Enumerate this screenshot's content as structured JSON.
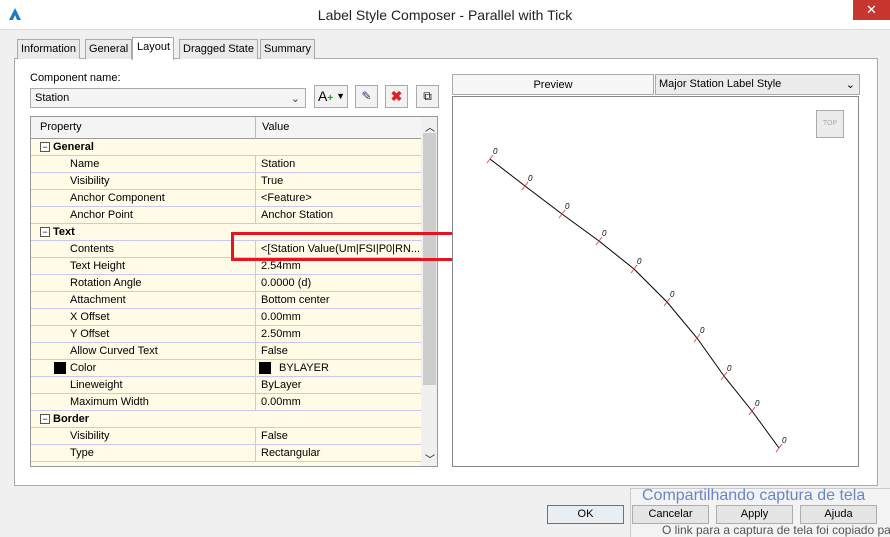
{
  "window": {
    "title": "Label Style Composer - Parallel with Tick",
    "close_icon": "close-icon"
  },
  "tabs": [
    {
      "label": "Information"
    },
    {
      "label": "General"
    },
    {
      "label": "Layout",
      "active": true
    },
    {
      "label": "Dragged State"
    },
    {
      "label": "Summary"
    }
  ],
  "component": {
    "label": "Component name:",
    "value": "Station"
  },
  "toolbar": {
    "add_text": "A",
    "add_icon": "add-text-component-icon",
    "copy_icon": "copy-component-icon",
    "delete_icon": "delete-icon",
    "order_icon": "component-draw-order-icon"
  },
  "grid": {
    "headers": [
      "Property",
      "Value"
    ],
    "rows": [
      {
        "type": "cat",
        "name": "General"
      },
      {
        "name": "Name",
        "value": "Station"
      },
      {
        "name": "Visibility",
        "value": "True"
      },
      {
        "name": "Anchor Component",
        "value": "<Feature>"
      },
      {
        "name": "Anchor Point",
        "value": "Anchor Station"
      },
      {
        "type": "cat",
        "name": "Text"
      },
      {
        "name": "Contents",
        "value": "<[Station Value(Um|FSI|P0|RN..."
      },
      {
        "name": "Text Height",
        "value": "2.54mm"
      },
      {
        "name": "Rotation Angle",
        "value": "0.0000 (d)"
      },
      {
        "name": "Attachment",
        "value": "Bottom center"
      },
      {
        "name": "X Offset",
        "value": "0.00mm"
      },
      {
        "name": "Y Offset",
        "value": "2.50mm"
      },
      {
        "name": "Allow Curved Text",
        "value": "False"
      },
      {
        "name": "Color",
        "value": "BYLAYER",
        "swatch": "#000000"
      },
      {
        "name": "Lineweight",
        "value": "ByLayer"
      },
      {
        "name": "Maximum Width",
        "value": "0.00mm"
      },
      {
        "type": "cat",
        "name": "Border"
      },
      {
        "name": "Visibility",
        "value": "False"
      },
      {
        "name": "Type",
        "value": "Rectangular"
      }
    ]
  },
  "highlight_color": "#e3151e",
  "preview": {
    "tab": "Preview",
    "style": "Major Station Label Style",
    "view_cube": "TOP",
    "label_text": "0",
    "tick_color": "#e05050"
  },
  "buttons": {
    "ok": "OK",
    "cancel": "Cancelar",
    "apply": "Apply",
    "help": "Ajuda"
  },
  "toast": {
    "title": "Compartilhando captura de tela",
    "message": "O link para a captura de tela foi copiado pa"
  }
}
